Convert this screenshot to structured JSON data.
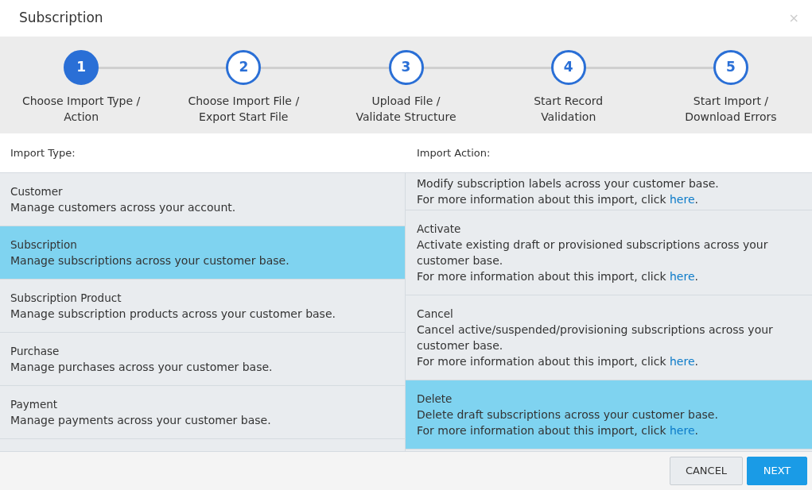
{
  "window": {
    "title": "Subscription",
    "close": "×"
  },
  "steps": [
    {
      "number": "1",
      "label": "Choose Import Type /\nAction",
      "selected": true
    },
    {
      "number": "2",
      "label": "Choose Import File /\nExport Start File",
      "selected": false
    },
    {
      "number": "3",
      "label": "Upload File /\nValidate Structure",
      "selected": false
    },
    {
      "number": "4",
      "label": "Start Record\nValidation",
      "selected": false
    },
    {
      "number": "5",
      "label": "Start Import /\nDownload Errors",
      "selected": false
    }
  ],
  "import_types": {
    "header": "Import Type:",
    "items": [
      {
        "title": "Customer",
        "description": "Manage customers across your account.",
        "selected": false
      },
      {
        "title": "Subscription",
        "description": "Manage subscriptions across your customer base.",
        "selected": true
      },
      {
        "title": "Subscription Product",
        "description": "Manage subscription products across your customer base.",
        "selected": false
      },
      {
        "title": "Purchase",
        "description": "Manage purchases across your customer base.",
        "selected": false
      },
      {
        "title": "Payment",
        "description": "Manage payments across your customer base.",
        "selected": false
      }
    ]
  },
  "import_actions": {
    "header": "Import Action:",
    "items": [
      {
        "description": "Modify subscription labels across your customer base.",
        "more": "For more information about this import, click ",
        "link": "here",
        "end": ".",
        "selected": false
      },
      {
        "title": "Activate",
        "description": "Activate existing draft or provisioned subscriptions across your customer base.",
        "more": "For more information about this import, click ",
        "link": "here",
        "end": ".",
        "selected": false
      },
      {
        "title": "Cancel",
        "description": "Cancel active/suspended/provisioning subscriptions across your customer base.",
        "more": "For more information about this import, click ",
        "link": "here",
        "end": ".",
        "selected": false
      },
      {
        "title": "Delete",
        "description": "Delete draft subscriptions across your customer base.",
        "more": "For more information about this import, click ",
        "link": "here",
        "end": ".",
        "selected": true
      }
    ]
  },
  "buttons": [
    {
      "label": "CANCEL",
      "kind": "secondary"
    },
    {
      "label": "NEXT",
      "kind": "primary"
    }
  ]
}
